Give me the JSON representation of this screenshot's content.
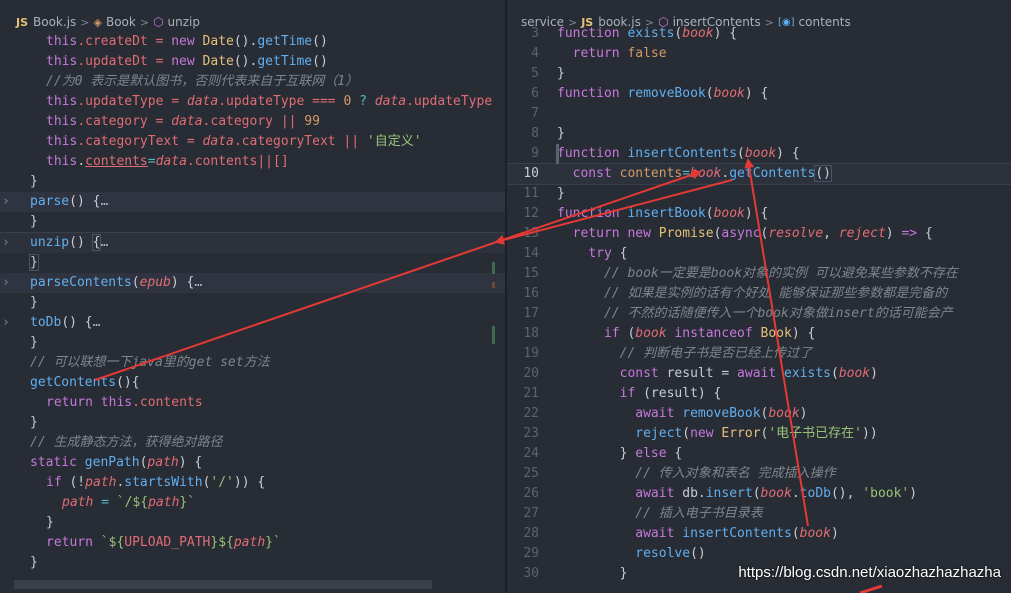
{
  "left_breadcrumb": {
    "file": "Book.js",
    "cls": "Book",
    "method": "unzip",
    "js": "JS"
  },
  "right_breadcrumb": {
    "folder": "service",
    "file": "book.js",
    "method": "insertContents",
    "symbol": "contents",
    "js": "JS"
  },
  "left_code": {
    "l1a": "this",
    "l1b": ".createDt = ",
    "l1c": "new",
    "l1d": "Date",
    "l1e": "().",
    "l1f": "getTime",
    "l1g": "()",
    "l2a": "this",
    "l2b": ".updateDt = ",
    "l2c": "new",
    "l2d": "Date",
    "l2e": "().",
    "l2f": "getTime",
    "l2g": "()",
    "l3": "//为0 表示是默认图书，否则代表来自于互联网（1）",
    "l4a": "this",
    "l4b": ".updateType = ",
    "l4c": "data",
    "l4d": ".updateType === ",
    "l4e": "0",
    "l4f": " ? ",
    "l4g": "data",
    "l4h": ".updateType",
    "l5a": "this",
    "l5b": ".category = ",
    "l5c": "data",
    "l5d": ".category || ",
    "l5e": "99",
    "l6a": "this",
    "l6b": ".categoryText = ",
    "l6c": "data",
    "l6d": ".categoryText || ",
    "l6e": "'自定义'",
    "l7a": "this",
    "l7b": ".",
    "l7c": "contents",
    "l7d": "=",
    "l7e": "data",
    "l7f": ".contents||[]",
    "l8": "}",
    "l9a": "parse",
    "l9b": "() {",
    "l9c": "…",
    "l10": "}",
    "l11a": "unzip",
    "l11b": "() ",
    "l11c": "{",
    "l11d": "…",
    "l12": "}",
    "l13a": "parseContents",
    "l13b": "(",
    "l13c": "epub",
    "l13d": ") {",
    "l13e": "…",
    "l14": "}",
    "l15a": "toDb",
    "l15b": "() {",
    "l15c": "…",
    "l16": "}",
    "l17": "// 可以联想一下java里的get set方法",
    "l18a": "getContents",
    "l18b": "(){",
    "l19a": "return",
    "l19b": " ",
    "l19c": "this",
    "l19d": ".contents",
    "l20": "}",
    "l21": "// 生成静态方法，获得绝对路径",
    "l22a": "static",
    "l22b": " ",
    "l22c": "genPath",
    "l22d": "(",
    "l22e": "path",
    "l22f": ") {",
    "l23a": "if",
    "l23b": " (!",
    "l23c": "path",
    "l23d": ".",
    "l23e": "startsWith",
    "l23f": "(",
    "l23g": "'/'",
    "l23h": ")) {",
    "l24a": "path",
    "l24b": " = ",
    "l24c": "`/${",
    "l24d": "path",
    "l24e": "}`",
    "l25": "}",
    "l26a": "return",
    "l26b": " ",
    "l26c": "`${",
    "l26d": "UPLOAD_PATH",
    "l26e": "}${",
    "l26f": "path",
    "l26g": "}`",
    "l27": "}"
  },
  "right_code": {
    "r3a": "function",
    "r3b": " ",
    "r3c": "exists",
    "r3d": "(",
    "r3e": "book",
    "r3f": ") {",
    "r4a": "return",
    "r4b": " ",
    "r4c": "false",
    "r5": "}",
    "r6a": "function",
    "r6b": " ",
    "r6c": "removeBook",
    "r6d": "(",
    "r6e": "book",
    "r6f": ") {",
    "r7": "",
    "r8": "}",
    "r9a": "function",
    "r9b": " ",
    "r9c": "insertContents",
    "r9d": "(",
    "r9e": "book",
    "r9f": ") {",
    "r10a": "const",
    "r10b": " ",
    "r10c": "contents",
    "r10d": "=",
    "r10e": "book",
    "r10f": ".",
    "r10g": "getContents",
    "r10h": "()",
    "r11": "}",
    "r12a": "function",
    "r12b": " ",
    "r12c": "insertBook",
    "r12d": "(",
    "r12e": "book",
    "r12f": ") {",
    "r13a": "return",
    "r13b": " ",
    "r13c": "new",
    "r13d": " ",
    "r13e": "Promise",
    "r13f": "(",
    "r13g": "async",
    "r13h": "(",
    "r13i": "resolve",
    "r13j": ", ",
    "r13k": "reject",
    "r13l": ") ",
    "r13m": "=>",
    "r13n": " {",
    "r14a": "try",
    "r14b": " {",
    "r15": "// book一定要是book对象的实例 可以避免某些参数不存在",
    "r16": "// 如果是实例的话有个好处 能够保证那些参数都是完备的",
    "r17": "// 不然的话随便传入一个book对象做insert的话可能会产",
    "r18a": "if",
    "r18b": " (",
    "r18c": "book",
    "r18d": " ",
    "r18e": "instanceof",
    "r18f": " ",
    "r18g": "Book",
    "r18h": ") {",
    "r19": "// 判断电子书是否已经上传过了",
    "r20a": "const",
    "r20b": " result = ",
    "r20c": "await",
    "r20d": " ",
    "r20e": "exists",
    "r20f": "(",
    "r20g": "book",
    "r20h": ")",
    "r21a": "if",
    "r21b": " (result) {",
    "r22a": "await",
    "r22b": " ",
    "r22c": "removeBook",
    "r22d": "(",
    "r22e": "book",
    "r22f": ")",
    "r23a": "reject",
    "r23b": "(",
    "r23c": "new",
    "r23d": " ",
    "r23e": "Error",
    "r23f": "(",
    "r23g": "'电子书已存在'",
    "r23h": "))",
    "r24a": "} ",
    "r24b": "else",
    "r24c": " {",
    "r25": "// 传入对象和表名 完成插入操作",
    "r26a": "await",
    "r26b": " db.",
    "r26c": "insert",
    "r26d": "(",
    "r26e": "book",
    "r26f": ".",
    "r26g": "toDb",
    "r26h": "(), ",
    "r26i": "'book'",
    "r26j": ")",
    "r27": "// 插入电子书目录表",
    "r28a": "await",
    "r28b": " ",
    "r28c": "insertContents",
    "r28d": "(",
    "r28e": "book",
    "r28f": ")",
    "r29a": "resolve",
    "r29b": "()",
    "r30": "}"
  },
  "line_numbers": [
    "3",
    "4",
    "5",
    "6",
    "7",
    "8",
    "9",
    "10",
    "11",
    "12",
    "13",
    "14",
    "15",
    "16",
    "17",
    "18",
    "19",
    "20",
    "21",
    "22",
    "23",
    "24",
    "25",
    "26",
    "27",
    "28",
    "29",
    "30"
  ],
  "watermark": "https://blog.csdn.net/xiaozhazhazhazha",
  "colors": {
    "arrow": "#e53935",
    "keyword": "#c678dd",
    "function": "#61afef",
    "string": "#98c379",
    "property": "#e06c75",
    "comment": "#7f848e"
  }
}
